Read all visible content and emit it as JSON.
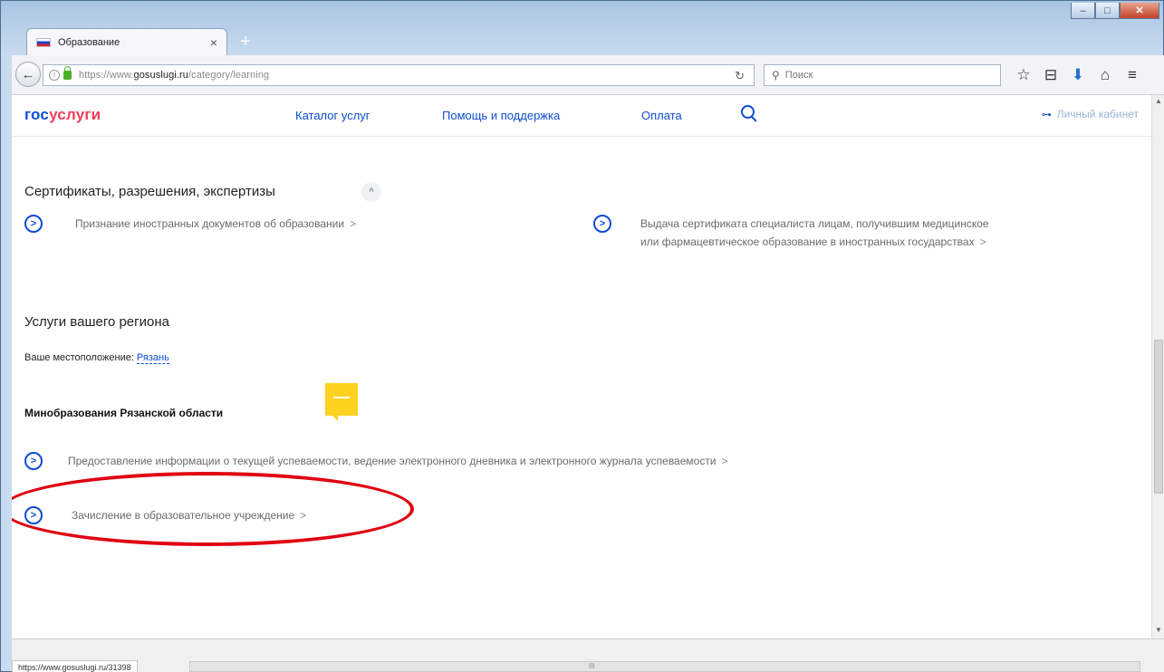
{
  "browser": {
    "tab_title": "Образование",
    "tab_close": "×",
    "new_tab": "+",
    "url_prefix": "https://www.",
    "url_domain": "gosuslugi.ru",
    "url_path": "/category/learning",
    "search_placeholder": "Поиск",
    "reload_icon": "↻",
    "back_icon": "←",
    "window_controls": [
      "–",
      "□",
      "✕"
    ],
    "toolbar_icons": [
      "☆",
      "⊟",
      "⬇",
      "⌂",
      "≡"
    ]
  },
  "header": {
    "logo_part1": "гос",
    "logo_part2": "услуги",
    "nav": [
      "Каталог услуг",
      "Помощь и поддержка",
      "Оплата"
    ],
    "cabinet": "Личный кабинет",
    "key_icon": "⊶"
  },
  "section": {
    "title": "Сертификаты, разрешения, экспертизы",
    "collapse_icon": "^",
    "services": [
      {
        "text": "Признание иностранных документов об образовании"
      },
      {
        "text_line1": "Выдача сертификата специалиста лицам, получившим медицинское",
        "text_line2": "или фармацевтическое образование в иностранных государствах"
      }
    ]
  },
  "region": {
    "title": "Услуги вашего региона",
    "location_label": "Ваше местоположение:",
    "location_city": "Рязань",
    "ministry": "Минобразования Рязанской области",
    "services": [
      {
        "text": "Предоставление информации о текущей успеваемости, ведение электронного дневника и электронного журнала успеваемости"
      },
      {
        "text": "Зачисление в образовательное учреждение"
      }
    ]
  },
  "service_arrow": ">",
  "chevron": ">",
  "status": {
    "url": "https://www.gosuslugi.ru/31398",
    "grip": "III"
  },
  "highlight_color": "#e00010"
}
